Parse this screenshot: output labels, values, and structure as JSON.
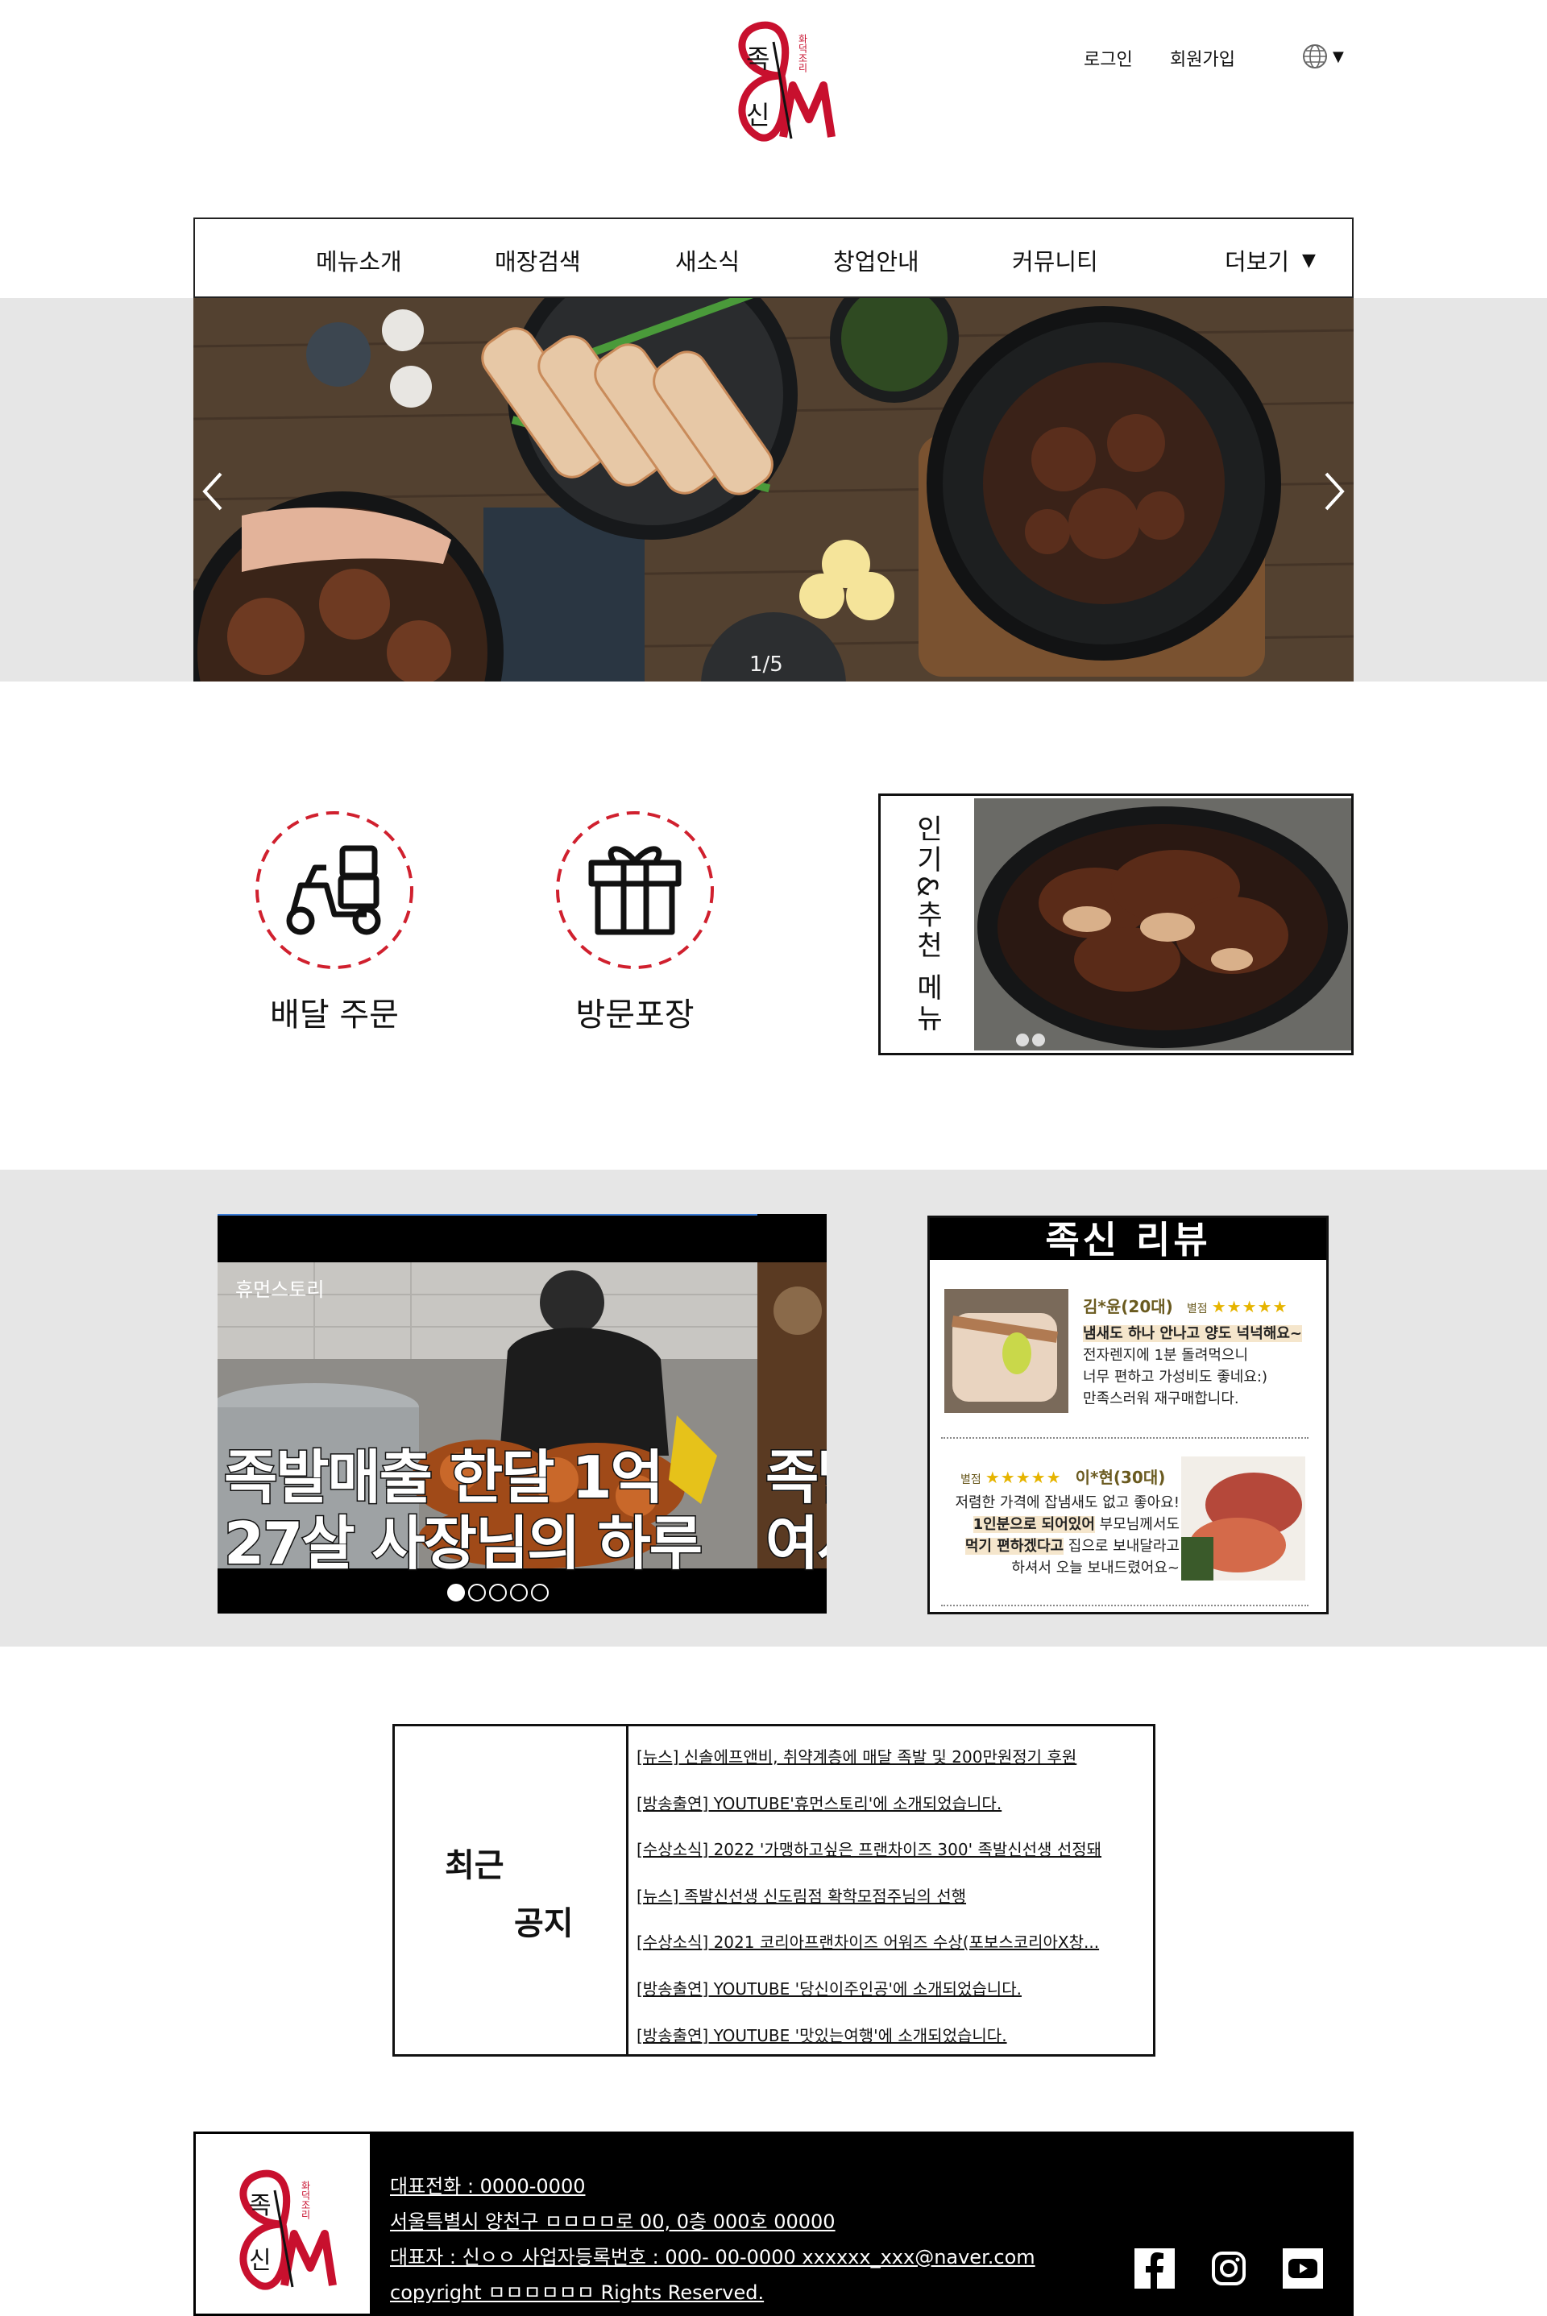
{
  "brand": {
    "logo_main_top": "족",
    "logo_main_bottom": "신",
    "logo_side": "화덕조리",
    "color_red": "#c8102e"
  },
  "header": {
    "login": "로그인",
    "signup": "회원가입",
    "language_icon": "globe-icon"
  },
  "nav": {
    "items": [
      "메뉴소개",
      "매장검색",
      "새소식",
      "창업안내",
      "커뮤니티"
    ],
    "more": "더보기"
  },
  "hero": {
    "counter": "1/5",
    "prev_icon": "chevron-left-icon",
    "next_icon": "chevron-right-icon"
  },
  "quick": {
    "delivery": "배달 주문",
    "takeout": "방문포장",
    "popular": "인기&추천 메뉴"
  },
  "video": {
    "tag": "휴먼스토리",
    "line1": "족발매출 한달 1억",
    "line2": "27살 사장님의 하루",
    "peek1": "족발",
    "peek2": "여사",
    "active_slide": 1,
    "total_slides": 5
  },
  "review": {
    "title": "족신 리뷰",
    "r1": {
      "name": "김*윤(20대)",
      "star_label": "별점",
      "stars": "★★★★★",
      "l1": "냄새도 하나 안나고 양도 넉넉해요~",
      "l2": "전자렌지에 1분 돌려먹으니",
      "l3": "너무 편하고 가성비도 좋네요:)",
      "l4": "만족스러워 재구매합니다."
    },
    "r2": {
      "name": "이*현(30대)",
      "star_label": "별점",
      "stars": "★★★★★",
      "l1": "저렴한 가격에 잡냄새도 없고 좋아요!",
      "l2a": "1인분으로 되어있어",
      "l2b": " 부모님께서도",
      "l3a": "먹기 편하겠다고",
      "l3b": " 집으로 보내달라고",
      "l4": "하셔서 오늘 보내드렸어요~"
    }
  },
  "notice": {
    "title1": "최근",
    "title2": "공지",
    "items": [
      "[뉴스] 신솔에프앤비, 취약계층에 매달 족발 및 200만원정기 후원",
      "[방송출연] YOUTUBE'휴먼스토리'에 소개되었습니다.",
      "[수상소식] 2022 '가맹하고싶은 프랜차이즈 300' 족발신선생 선정돼",
      "[뉴스] 족발신선생 신도림점 확학모점주님의 선행",
      "[수상소식] 2021 코리아프랜차이즈 어워즈 수상(포보스코리아X창...",
      "[방송출연] YOUTUBE '당신이주인공'에 소개되었습니다.",
      "[방송출연] YOUTUBE '맛있는여행'에 소개되었습니다.  "
    ]
  },
  "footer": {
    "phone": "대표전화 : 0000-0000",
    "address": "서울특별시 양천구 ㅁㅁㅁㅁ로 00, 0층 000호 00000",
    "owner": "대표자 : 신ㅇㅇ 사업자등록번호 : 000- 00-0000 xxxxxx_xxx@naver.com",
    "copyright": "copyright ㅁㅁㅁㅁㅁㅁ Rights Reserved.",
    "social": [
      "facebook-icon",
      "instagram-icon",
      "youtube-icon"
    ]
  }
}
